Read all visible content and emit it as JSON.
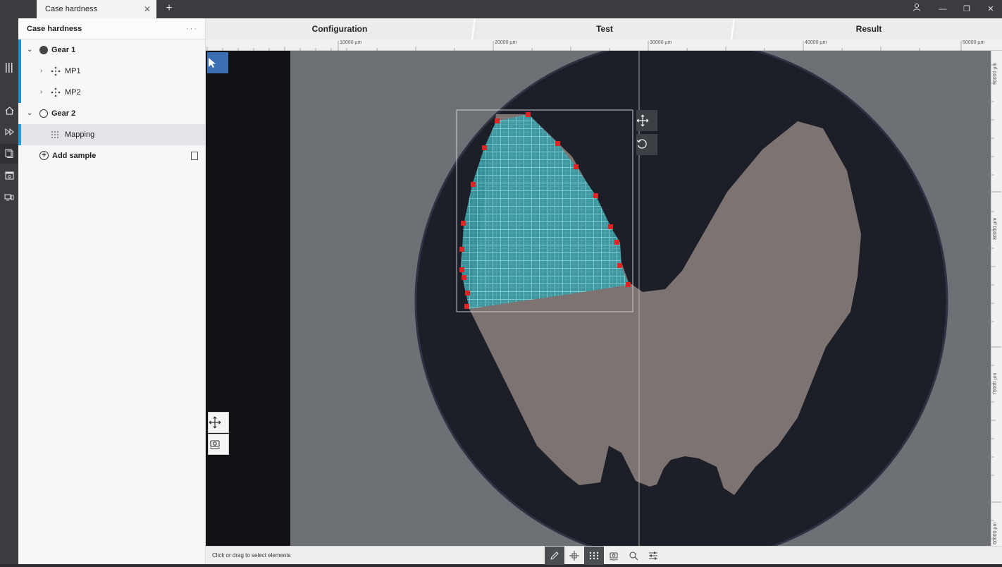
{
  "window": {
    "tab_title": "Case hardness",
    "tab_close": "✕",
    "new_tab": "+",
    "controls": {
      "user": "user-icon",
      "minimize": "—",
      "restore": "❐",
      "close": "✕"
    }
  },
  "rail": {
    "items": [
      "menu-icon",
      "home-icon",
      "fast-forward-icon",
      "documents-icon",
      "image-frame-icon",
      "devices-icon"
    ]
  },
  "tree": {
    "title": "Case hardness",
    "more": "···",
    "items": [
      {
        "label": "Gear 1",
        "type": "sample",
        "state": "filled"
      },
      {
        "label": "MP1",
        "type": "measurement"
      },
      {
        "label": "MP2",
        "type": "measurement"
      },
      {
        "label": "Gear 2",
        "type": "sample",
        "state": "empty"
      },
      {
        "label": "Mapping",
        "type": "mapping",
        "selected": true
      }
    ],
    "add_sample": "Add sample"
  },
  "steps": [
    {
      "label": "Configuration"
    },
    {
      "label": "Test"
    },
    {
      "label": "Result"
    }
  ],
  "ruler_top": [
    "10000 µm",
    "20000 µm",
    "30000 µm",
    "40000 µm",
    "50000 µm"
  ],
  "ruler_right": [
    "90000 µm",
    "80000 µm",
    "70000 µm",
    "60000 µm"
  ],
  "status": {
    "text": "Click or drag to select elements"
  },
  "colors": {
    "accent": "#3c6eb4",
    "tree_bar": "#1f8fc8",
    "grid": "#3fb8c0",
    "vertex": "#e02424"
  }
}
